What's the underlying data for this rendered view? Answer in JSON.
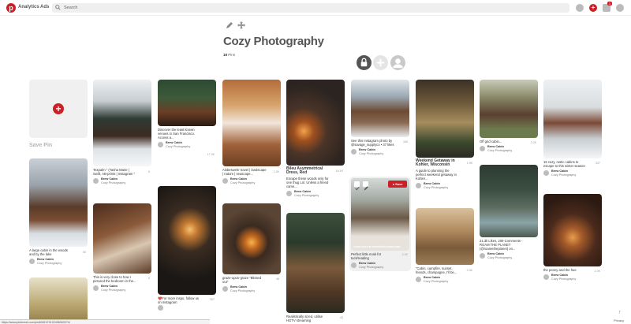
{
  "topbar": {
    "nav_analytics": "Analytics",
    "nav_ads": "Ads",
    "search_placeholder": "Search",
    "notification_count": "1"
  },
  "board": {
    "title": "Cozy Photography",
    "pin_count": "18",
    "pin_label": "Pins"
  },
  "save_pin_label": "Save Pin",
  "pins": [
    {
      "caption": "A large cabin in the woods and by the lake",
      "count": "50",
      "user": "Brew Cabin",
      "board": "Cozy Photography"
    },
    {
      "caption": "",
      "count": "",
      "user": "",
      "board": ""
    },
    {
      "caption": "Texpalm \" (Tasha Marie | Swift, AB-prints | Instagram \"",
      "count": "6",
      "user": "Brew Cabin",
      "board": "Cozy Photography"
    },
    {
      "caption": "This is very close to how I pictured the bedroom in the...",
      "count": "6",
      "user": "Brew Cabin",
      "board": "Cozy Photography"
    },
    {
      "caption": "Discover the least known venues in San Francisco. Access a...",
      "count": "17.3K",
      "user": "Brew Cabin",
      "board": "Cozy Photography"
    },
    {
      "caption": "❤️For more inspo, follow us on Instagram",
      "count": "307",
      "user": "Brew Cabin",
      "board": "Cozy Photography"
    },
    {
      "caption": "Aisbeswehr travel | landscape | nature | seascape...",
      "count": "1.3K",
      "user": "Brew Cabin",
      "board": "Cozy Photography"
    },
    {
      "caption": "graze-upon-graze \"Blissed out\"",
      "count": "48",
      "user": "Brew Cabin",
      "board": "Cozy Photography"
    },
    {
      "caption": "Bileu Asymmetrical Dress, Red",
      "count": "16.1K",
      "user": "Brew Cabin",
      "board": "Cozy Photography",
      "sub": "Escape these woods only for one thug Lol. Unless a friend came..."
    },
    {
      "caption": "Realistically sized, utilise HGTV streaming",
      "count": "43",
      "user": "",
      "board": ""
    },
    {
      "caption": "See this Instagram photo by @savage_supplyco • 37 likes",
      "count": "165",
      "user": "Brew Cabin",
      "board": "Cozy Photography"
    },
    {
      "caption": "Perfect little nook for tuck/reading",
      "count": "2.2K",
      "user": "Brew Cabin",
      "board": "Cozy Photography",
      "overlay": "Learn more at homesdiet.tumblr.com",
      "save": "Save"
    },
    {
      "caption": "Weekend Getaway in Kohler, Wisconsin",
      "count": "1.9K",
      "user": "Brew Cabin",
      "board": "Cozy Photography",
      "sub": "A guide to planning the perfect weekend getaway in Kohler..."
    },
    {
      "caption": "\"Cabin, campfire, sunset, friends, champagne, I'll be...",
      "count": "2.3K",
      "user": "Brew Cabin",
      "board": "Cozy Photography"
    },
    {
      "caption": "Off grid cabin...",
      "count": "2.2K",
      "user": "Brew Cabin",
      "board": "Cozy Photography"
    },
    {
      "caption": "21.3k Likes, 209 Comments - ROAM THE PLANET (@roametheplanet) on...",
      "count": "",
      "user": "Brew Cabin",
      "board": "Cozy Photography"
    },
    {
      "caption": "15 cozy, rustic cabins to escape to this winter season",
      "count": "337",
      "user": "Brew Cabin",
      "board": "Cozy Photography"
    },
    {
      "caption": "the peony and the hue",
      "count": "1.0K",
      "user": "Brew Cabin",
      "board": "Cozy Photography"
    }
  ],
  "status_url": "https://www.pinterest.com/pin/608197010249606327/#",
  "privacy_label": "Privacy",
  "colors": {
    "brand": "#cb2027"
  }
}
